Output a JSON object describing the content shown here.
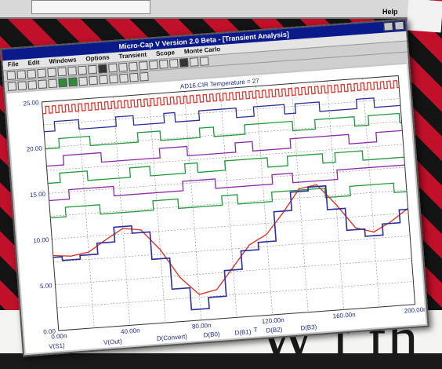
{
  "top": {
    "help_label": "Help"
  },
  "window": {
    "title": "Micro-Cap V Version 2.0 Beta - [Transient Analysis]",
    "menu": [
      "File",
      "Edit",
      "Windows",
      "Options",
      "Transient",
      "Scope",
      "Monte Carlo"
    ]
  },
  "plot": {
    "header": "AD16.CIR Temperature = 27",
    "y_ticks": [
      "25.00",
      "20.00",
      "15.00",
      "10.00",
      "5.00",
      "0.00"
    ],
    "x_ticks": [
      "0.00n",
      "40.00n",
      "80.00n",
      "120.00n",
      "160.00n",
      "200.00n"
    ],
    "x_axis_label": "T",
    "traces": [
      "V(S1)",
      "V(Out)",
      "D(Convert)",
      "D(B0)",
      "D(B1)",
      "D(B2)",
      "D(B3)"
    ],
    "colors": {
      "red": "#e0352b",
      "blue": "#2a2f9c",
      "green": "#1f9a3a",
      "purple": "#8a2aa8",
      "grid": "#888888"
    }
  },
  "backdrop": {
    "headline_fragment": "W t th"
  },
  "chart_data": {
    "type": "line",
    "xlabel": "T",
    "ylabel": "",
    "xlim": [
      0,
      200
    ],
    "ylim": [
      0,
      25
    ],
    "series": [
      {
        "name": "V(S1)",
        "x": [
          0,
          10,
          20,
          30,
          40,
          50,
          60,
          70,
          80,
          90,
          100,
          110,
          120,
          130,
          140,
          150,
          160,
          170,
          180,
          190,
          200
        ],
        "values": [
          8.2,
          8.0,
          8.3,
          9.5,
          10.6,
          10.3,
          8.0,
          4.8,
          2.8,
          3.2,
          5.5,
          7.8,
          8.8,
          11.0,
          13.5,
          13.8,
          11.5,
          8.8,
          8.2,
          9.2,
          10.5
        ]
      },
      {
        "name": "V(Out)",
        "x": [
          0,
          10,
          20,
          30,
          40,
          50,
          60,
          70,
          80,
          90,
          100,
          110,
          120,
          130,
          140,
          150,
          160,
          170,
          180,
          190,
          200
        ],
        "values": [
          8.0,
          7.6,
          8.0,
          9.2,
          10.8,
          10.0,
          7.0,
          3.6,
          1.2,
          2.4,
          5.2,
          7.2,
          8.0,
          11.2,
          13.2,
          13.6,
          11.0,
          8.6,
          7.8,
          9.0,
          10.4
        ]
      }
    ]
  }
}
